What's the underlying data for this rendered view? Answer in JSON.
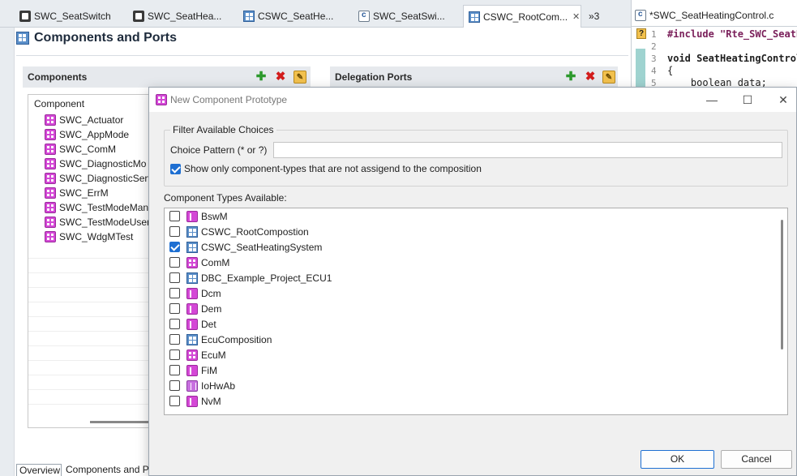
{
  "tabs": [
    {
      "label": "SWC_SeatSwitch",
      "icon": "component-icon"
    },
    {
      "label": "SWC_SeatHea...",
      "icon": "component-icon"
    },
    {
      "label": "CSWC_SeatHe...",
      "icon": "composition-icon"
    },
    {
      "label": "SWC_SeatSwi...",
      "icon": "c-file-icon"
    },
    {
      "label": "CSWC_RootCom...",
      "icon": "composition-icon"
    }
  ],
  "tab_overflow": "»3",
  "editor": {
    "title": "Components and Ports"
  },
  "components_panel": {
    "header": "Components",
    "column": "Component",
    "items": [
      "SWC_Actuator",
      "SWC_AppMode",
      "SWC_ComM",
      "SWC_DiagnosticMo",
      "SWC_DiagnosticServ",
      "SWC_ErrM",
      "SWC_TestModeMan",
      "SWC_TestModeUser",
      "SWC_WdgMTest"
    ]
  },
  "delegation_panel": {
    "header": "Delegation Ports"
  },
  "bottom_tabs": [
    "Overview",
    "Components and P"
  ],
  "code_editor": {
    "tab": "*SWC_SeatHeatingControl.c",
    "lines": [
      {
        "n": "1",
        "text": "#include \"Rte_SWC_SeatH"
      },
      {
        "n": "2",
        "text": ""
      },
      {
        "n": "3",
        "text": "void SeatHeatingControl"
      },
      {
        "n": "4",
        "text": "{"
      },
      {
        "n": "5",
        "text": "    boolean data;"
      }
    ]
  },
  "dialog": {
    "title": "New Component Prototype",
    "filter_group": "Filter Available Choices",
    "choice_label": "Choice Pattern (* or ?)",
    "choice_value": "",
    "show_only_label": "Show only component-types that are not assigend to the composition",
    "show_only_checked": true,
    "available_label": "Component Types Available:",
    "types": [
      {
        "label": "BswM",
        "icon": "bsw",
        "checked": false
      },
      {
        "label": "CSWC_RootCompostion",
        "icon": "csw",
        "checked": false
      },
      {
        "label": "CSWC_SeatHeatingSystem",
        "icon": "csw",
        "checked": true
      },
      {
        "label": "ComM",
        "icon": "swc",
        "checked": false
      },
      {
        "label": "DBC_Example_Project_ECU1",
        "icon": "csw",
        "checked": false
      },
      {
        "label": "Dcm",
        "icon": "bsw",
        "checked": false
      },
      {
        "label": "Dem",
        "icon": "bsw",
        "checked": false
      },
      {
        "label": "Det",
        "icon": "bsw",
        "checked": false
      },
      {
        "label": "EcuComposition",
        "icon": "csw",
        "checked": false
      },
      {
        "label": "EcuM",
        "icon": "swc",
        "checked": false
      },
      {
        "label": "FiM",
        "icon": "bsw",
        "checked": false
      },
      {
        "label": "IoHwAb",
        "icon": "io",
        "checked": false
      },
      {
        "label": "NvM",
        "icon": "bsw",
        "checked": false
      }
    ],
    "ok": "OK",
    "cancel": "Cancel"
  }
}
